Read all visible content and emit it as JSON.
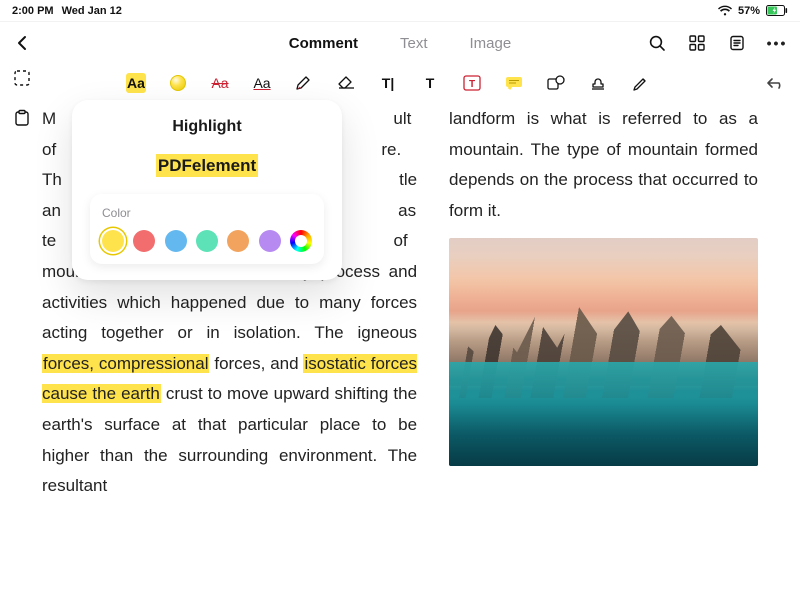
{
  "status": {
    "time": "2:00 PM",
    "date": "Wed Jan 12",
    "battery_pct": "57%"
  },
  "nav": {
    "tabs": {
      "comment": "Comment",
      "text": "Text",
      "image": "Image"
    }
  },
  "toolbar": {
    "highlight_label": "Aa",
    "strike_label": "Aa",
    "underline_label": "Aa",
    "text_cursor": "T|",
    "text_T": "T",
    "text_box": "T"
  },
  "popover": {
    "title": "Highlight",
    "demo": "PDFelement",
    "color_label": "Color",
    "swatches": [
      {
        "name": "yellow",
        "hex": "#ffe34d",
        "selected": true
      },
      {
        "name": "red",
        "hex": "#f26d6d"
      },
      {
        "name": "blue",
        "hex": "#64b8f0"
      },
      {
        "name": "teal",
        "hex": "#5ce2b6"
      },
      {
        "name": "orange",
        "hex": "#f2a35e"
      },
      {
        "name": "purple",
        "hex": "#b68af0"
      },
      {
        "name": "custom",
        "hex": "rainbow"
      }
    ]
  },
  "doc": {
    "left": {
      "chunk1_pre": "M",
      "chunk1_gap": "ult of",
      "line2_gap": "re. Th",
      "line3_gap": "tle an",
      "line4_gap": "as te",
      "line5_tail": "of mountain formation involves many process and activities which happened due to many forces acting together or in isolation. The igneous ",
      "hl1": "forces, compressional",
      "between1": " forces, and ",
      "hl2": "isostatic forces cause the earth",
      "after2": " crust to move upward shifting the earth's surface at that particular place to be higher than the surrounding environment. The resultant"
    },
    "right": {
      "para": "landform is what is referred to as a mountain. The type of mountain formed depends on the process that occurred to form it."
    }
  }
}
